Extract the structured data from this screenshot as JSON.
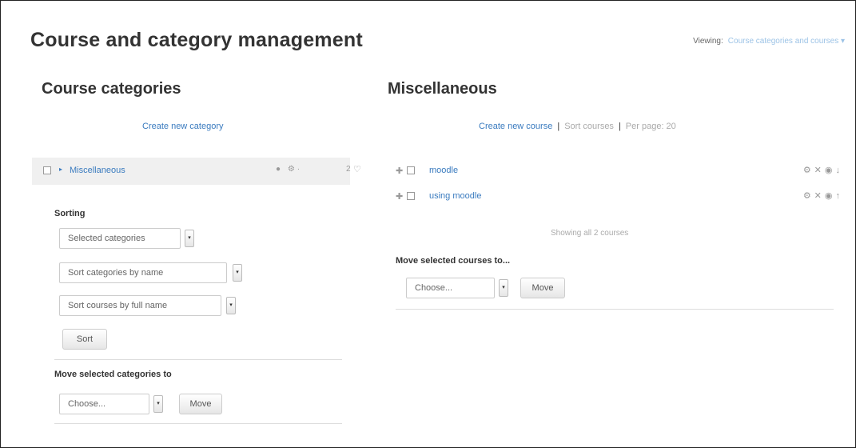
{
  "header": {
    "title": "Course and category management",
    "viewing_label": "Viewing:",
    "viewing_value": "Course categories and courses ▾"
  },
  "left": {
    "heading": "Course categories",
    "create_link": "Create new category",
    "category": {
      "name": "Miscellaneous",
      "caret": "▸",
      "action_icons": "● ⚙·",
      "course_count": "2",
      "count_icon": "♡"
    },
    "sorting": {
      "label": "Sorting",
      "selects": [
        "Selected categories",
        "Sort categories by name",
        "Sort courses by full name"
      ],
      "button": "Sort"
    },
    "move": {
      "label": "Move selected categories to",
      "select": "Choose...",
      "button": "Move"
    }
  },
  "right": {
    "heading": "Miscellaneous",
    "create_link": "Create new course",
    "sort_courses": "Sort courses",
    "per_page": "Per page: 20",
    "courses": [
      {
        "name": "moodle",
        "actions": "⚙✕◉↓"
      },
      {
        "name": "using moodle",
        "actions": "⚙✕◉↑"
      }
    ],
    "move_icon": "✚",
    "showing": "Showing all 2 courses",
    "move": {
      "label": "Move selected courses to...",
      "select": "Choose...",
      "button": "Move"
    }
  },
  "icons": {
    "dropdown": "▾",
    "separator": "|"
  }
}
